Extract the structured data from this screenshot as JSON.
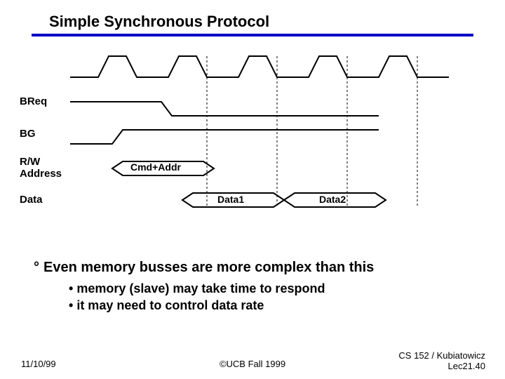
{
  "title": "Simple Synchronous Protocol",
  "signals": {
    "breq": "BReq",
    "bg": "BG",
    "rw": "R/W\nAddress",
    "data": "Data"
  },
  "labels": {
    "cmdaddr": "Cmd+Addr",
    "data1": "Data1",
    "data2": "Data2"
  },
  "bullets": {
    "main": "Even memory busses are more complex than this",
    "sub1": "memory (slave) may take time to respond",
    "sub2": "it may need to control data rate"
  },
  "footer": {
    "date": "11/10/99",
    "center": "©UCB Fall 1999",
    "right1": "CS 152 / Kubiatowicz",
    "right2": "Lec21.40"
  }
}
